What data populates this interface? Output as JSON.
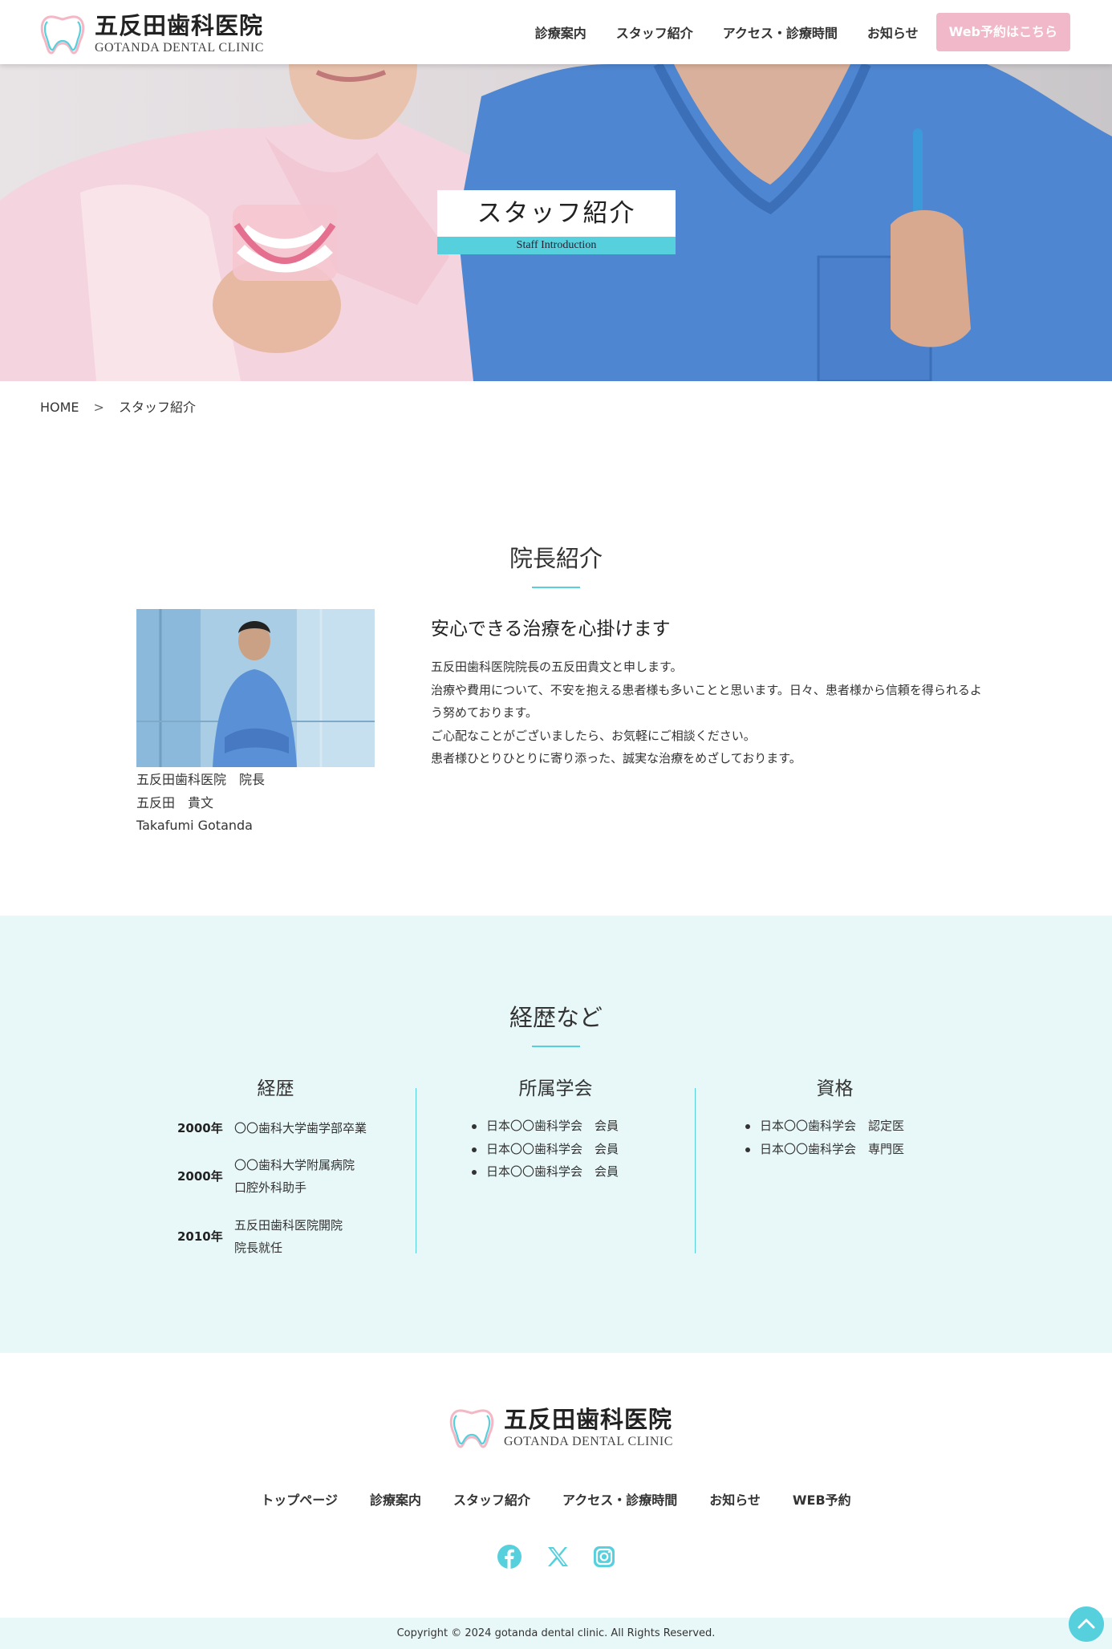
{
  "header": {
    "logo_jp": "五反田歯科医院",
    "logo_en": "GOTANDA DENTAL CLINIC",
    "nav": [
      "診療案内",
      "スタッフ紹介",
      "アクセス・診療時間",
      "お知らせ"
    ],
    "cta": "Web予約はこちら"
  },
  "hero": {
    "title": "スタッフ紹介",
    "subtitle": "Staff Introduction"
  },
  "breadcrumb": {
    "home": "HOME",
    "sep": ">",
    "current": "スタッフ紹介"
  },
  "director": {
    "section_title": "院長紹介",
    "caption": [
      "五反田歯科医院　院長",
      "五反田　貴文",
      "Takafumi Gotanda"
    ],
    "heading": "安心できる治療を心掛けます",
    "body": [
      "五反田歯科医院院長の五反田貴文と申します。",
      "治療や費用について、不安を抱える患者様も多いことと思います。日々、患者様から信頼を得られるよう努めております。",
      "ご心配なことがございましたら、お気軽にご相談ください。",
      "患者様ひとりひとりに寄り添った、誠実な治療をめざしております。"
    ]
  },
  "career": {
    "section_title": "経歴など",
    "history_title": "経歴",
    "history": [
      {
        "year": "2000年",
        "lines": [
          "〇〇歯科大学歯学部卒業"
        ]
      },
      {
        "year": "2000年",
        "lines": [
          "〇〇歯科大学附属病院",
          "口腔外科助手"
        ]
      },
      {
        "year": "2010年",
        "lines": [
          "五反田歯科医院開院",
          "院長就任"
        ]
      }
    ],
    "society_title": "所属学会",
    "societies": [
      "日本〇〇歯科学会　会員",
      "日本〇〇歯科学会　会員",
      "日本〇〇歯科学会　会員"
    ],
    "license_title": "資格",
    "licenses": [
      "日本〇〇歯科学会　認定医",
      "日本〇〇歯科学会　専門医"
    ]
  },
  "footer": {
    "logo_jp": "五反田歯科医院",
    "logo_en": "GOTANDA DENTAL CLINIC",
    "nav": [
      "トップページ",
      "診療案内",
      "スタッフ紹介",
      "アクセス・診療時間",
      "お知らせ",
      "WEB予約"
    ],
    "social": [
      "facebook-icon",
      "x-icon",
      "instagram-icon"
    ],
    "copyright": "Copyright © 2024 gotanda dental clinic. All Rights Reserved."
  },
  "colors": {
    "accent": "#56d0dc",
    "cta": "#f0b8c8",
    "pale_bg": "#e8f7f7"
  }
}
